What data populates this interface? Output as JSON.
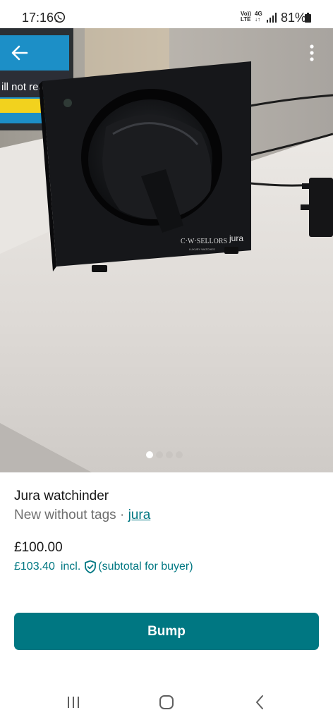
{
  "status_bar": {
    "time": "17:16",
    "network_top": "Vo))",
    "network_bottom": "LTE",
    "network_type_top": "4G",
    "network_type_bottom": "↓↑",
    "battery": "81%"
  },
  "photo": {
    "brand_print": "C·W·SELLORS",
    "brand_print_sub": "LUXURY WATCHES",
    "brand_print_2": "jura",
    "screen_text": "ill not rea",
    "page_count": 4,
    "active_page": 1
  },
  "listing": {
    "title": "Jura watchinder",
    "condition": "New without tags",
    "separator": " · ",
    "brand": "jura",
    "price": "£100.00",
    "buyer_price": "£103.40",
    "buyer_price_incl": "incl.",
    "buyer_price_note": "(subtotal for buyer)"
  },
  "actions": {
    "bump_label": "Bump"
  },
  "colors": {
    "accent": "#007782",
    "text": "#171717",
    "muted": "#6f6f6f"
  },
  "icons": [
    "whatsapp-icon",
    "signal-icon",
    "battery-icon",
    "back-arrow-icon",
    "more-vertical-icon",
    "shield-check-icon",
    "nav-recent-icon",
    "nav-home-icon",
    "nav-back-icon"
  ]
}
